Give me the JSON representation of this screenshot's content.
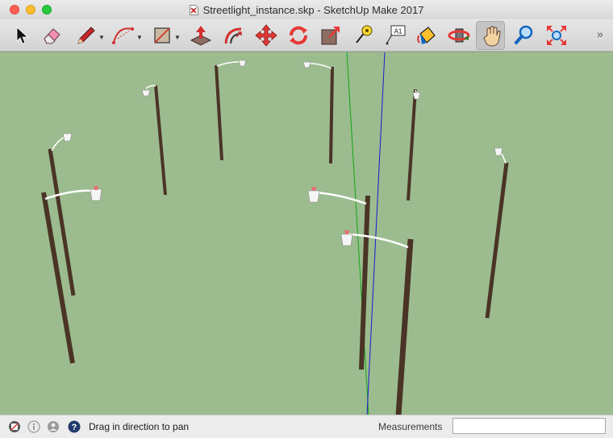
{
  "window": {
    "title": "Streetlight_instance.skp - SketchUp Make 2017"
  },
  "toolbar": {
    "tools": [
      {
        "name": "select-tool",
        "icon": "arrow-cursor-icon"
      },
      {
        "name": "eraser-tool",
        "icon": "eraser-icon"
      },
      {
        "name": "line-tool",
        "icon": "pencil-icon"
      },
      {
        "name": "arc-tool",
        "icon": "arc-icon"
      },
      {
        "name": "shape-tool",
        "icon": "rectangle-icon"
      },
      {
        "name": "push-pull-tool",
        "icon": "push-pull-icon"
      },
      {
        "name": "offset-tool",
        "icon": "offset-icon"
      },
      {
        "name": "move-tool",
        "icon": "move-arrows-icon"
      },
      {
        "name": "rotate-tool",
        "icon": "rotate-icon"
      },
      {
        "name": "scale-tool",
        "icon": "scale-icon"
      },
      {
        "name": "tape-measure-tool",
        "icon": "tape-measure-icon"
      },
      {
        "name": "text-tool",
        "icon": "text-label-icon"
      },
      {
        "name": "paint-bucket-tool",
        "icon": "paint-bucket-icon"
      },
      {
        "name": "orbit-tool",
        "icon": "orbit-icon"
      },
      {
        "name": "pan-tool",
        "icon": "hand-icon",
        "active": true
      },
      {
        "name": "zoom-tool",
        "icon": "magnifier-icon"
      },
      {
        "name": "zoom-extents-tool",
        "icon": "zoom-extents-icon"
      }
    ],
    "text_tool_label": "A1",
    "overflow_label": "»"
  },
  "viewport": {
    "background_color": "#9cbc8f",
    "pole_color": "#4a3426",
    "green_axis_color": "#11a611",
    "blue_axis_color": "#1a1acc"
  },
  "statusbar": {
    "hint": "Drag in direction to pan",
    "measurements_label": "Measurements",
    "measurements_value": ""
  }
}
